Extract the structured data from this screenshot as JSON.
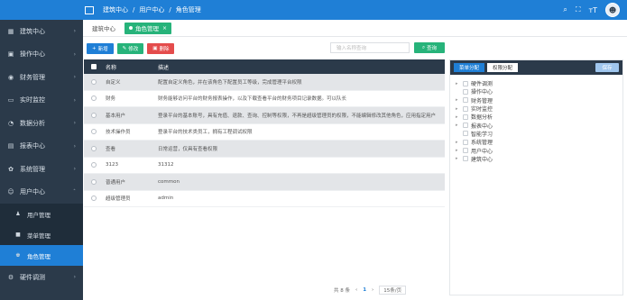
{
  "topbar": {
    "breadcrumb": [
      "建筑中心",
      "用户中心",
      "角色管理"
    ],
    "separator": "/"
  },
  "sidebar": {
    "items": [
      {
        "label": "建筑中心",
        "icon": "building-icon"
      },
      {
        "label": "操作中心",
        "icon": "grid-icon"
      },
      {
        "label": "财务管理",
        "icon": "finance-icon"
      },
      {
        "label": "实时监控",
        "icon": "monitor-icon"
      },
      {
        "label": "数据分析",
        "icon": "chart-icon"
      },
      {
        "label": "报表中心",
        "icon": "report-icon"
      },
      {
        "label": "系统管理",
        "icon": "gear-icon"
      },
      {
        "label": "用户中心",
        "icon": "user-icon"
      }
    ],
    "sub_items": [
      {
        "label": "用户管理",
        "icon": "users-icon"
      },
      {
        "label": "菜单管理",
        "icon": "menu-icon"
      },
      {
        "label": "角色管理",
        "icon": "role-icon"
      }
    ],
    "bottom_item": {
      "label": "硬件调测",
      "icon": "hardware-icon"
    }
  },
  "tabs": [
    {
      "label": "建筑中心"
    },
    {
      "label": "角色管理"
    }
  ],
  "toolbar": {
    "add_label": "新增",
    "edit_label": "修改",
    "delete_label": "删除",
    "search_placeholder": "输入名称查询",
    "search_label": "查询"
  },
  "table": {
    "headers": [
      "名称",
      "描述"
    ],
    "rows": [
      {
        "name": "自定义",
        "desc": "配置自定义角色，并在该角色下配置员工等级，完成管理平台权限"
      },
      {
        "name": "财务",
        "desc": "财务能够访问平台的财务报表操作，以及下载查看平台的财务项目记录数据。可以队长"
      },
      {
        "name": "基本用户",
        "desc": "登录平台的基本账号，具有充值、退款、查询、控制等权限，不再是超级管理员的权限，不能编辑修改其他角色，应用指定用户"
      },
      {
        "name": "技术操作员",
        "desc": "登录平台的技术类员工，拥有工程调试权限"
      },
      {
        "name": "查看",
        "desc": "日常运营，仅具有查看权限"
      },
      {
        "name": "3123",
        "desc": "31312"
      },
      {
        "name": "普通用户",
        "desc": "common"
      },
      {
        "name": "超级管理员",
        "desc": "admin"
      }
    ]
  },
  "pager": {
    "total": "共 8 条",
    "prev": "‹",
    "page": "1",
    "next": "›",
    "page_size": "15条/页"
  },
  "panel": {
    "tab_menu": "菜单分配",
    "tab_perm": "权限分配",
    "save_label": "保存",
    "tree": [
      "硬件调测",
      "操作中心",
      "财务管理",
      "实时监控",
      "数据分析",
      "报表中心",
      "智能学习",
      "系统管理",
      "用户中心",
      "建筑中心"
    ]
  }
}
